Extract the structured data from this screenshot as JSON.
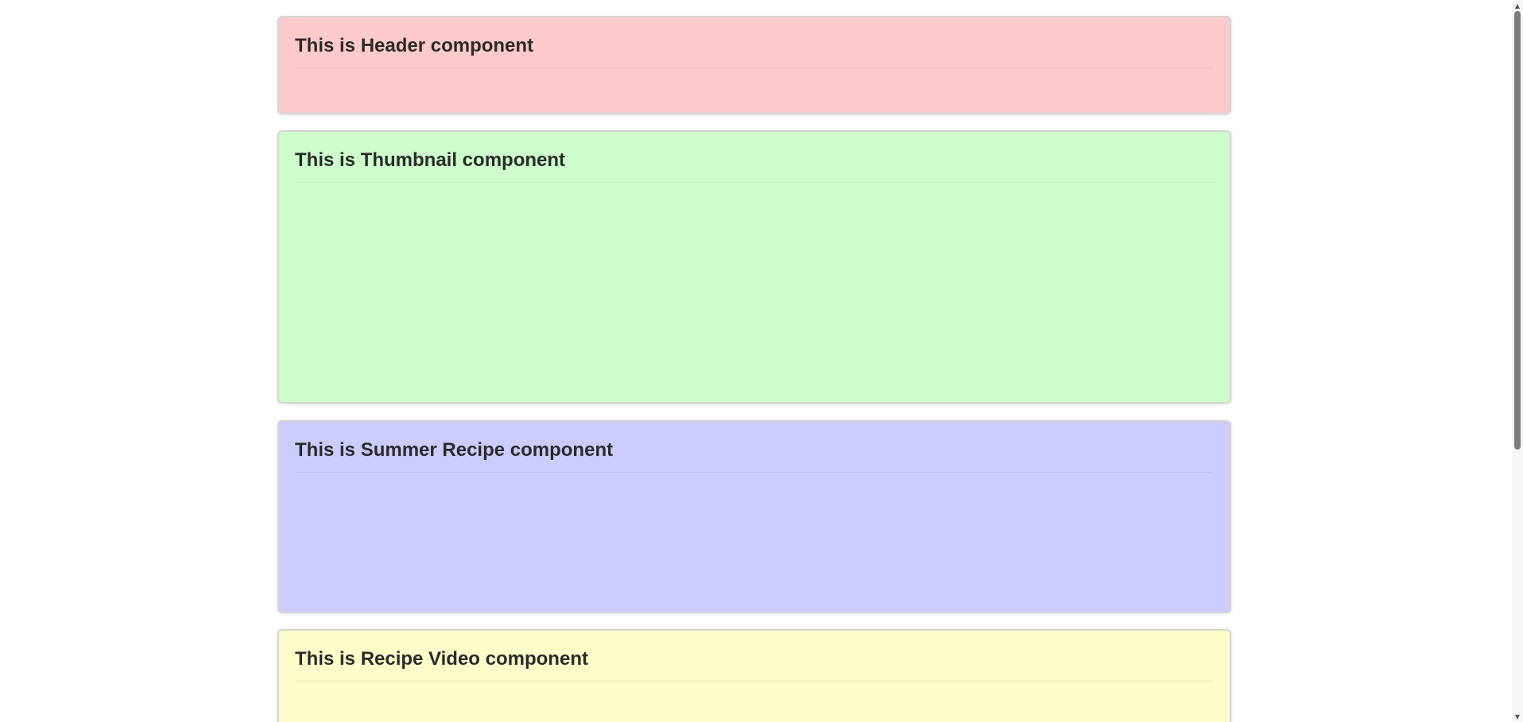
{
  "cards": [
    {
      "title": "This is Header component",
      "bg": "#fecacb"
    },
    {
      "title": "This is Thumbnail component",
      "bg": "#cdfecc"
    },
    {
      "title": "This is Summer Recipe component",
      "bg": "#ccccfe"
    },
    {
      "title": "This is Recipe Video component",
      "bg": "#fefecb"
    }
  ],
  "scrollbar": {
    "up_icon": "scroll-up-arrow",
    "down_icon": "scroll-down-arrow",
    "position": 0
  }
}
